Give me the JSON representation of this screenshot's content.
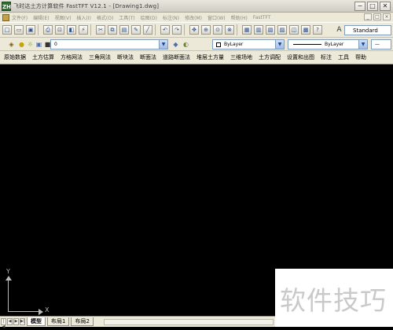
{
  "window": {
    "app_icon": "ZH",
    "title": "飞时达土方计算软件 FastTFT V12.1 - [Drawing1.dwg]",
    "minimize": "−",
    "maximize": "□",
    "close": "✕"
  },
  "menu": {
    "items": [
      "文件(F)",
      "编辑(E)",
      "视图(V)",
      "插入(I)",
      "格式(O)",
      "工具(T)",
      "绘图(D)",
      "标注(N)",
      "修改(M)",
      "窗口(W)",
      "帮助(H)",
      "FastTFT"
    ],
    "doc_min": "_",
    "doc_max": "□",
    "doc_close": "×"
  },
  "toolbar1": {
    "icons": [
      "new-icon",
      "open-icon",
      "save-icon",
      "print-icon",
      "preview-icon",
      "plot-icon",
      "publish-icon",
      "cut-icon",
      "copy-icon",
      "paste-icon",
      "match-icon",
      "brush-icon",
      "undo-icon",
      "redo-icon",
      "pan-icon",
      "zoom-realtime-icon",
      "zoom-window-icon",
      "zoom-previous-icon",
      "properties-icon",
      "design-center-icon",
      "tool-palettes-icon",
      "sheet-set-icon",
      "markup-icon",
      "calculator-icon",
      "help-icon"
    ],
    "glyphs": [
      "□",
      "▭",
      "▣",
      "⎙",
      "⊡",
      "◧",
      "⚡",
      "✂",
      "⧉",
      "▤",
      "✎",
      "╱",
      "↶",
      "↷",
      "✥",
      "⊕",
      "⊙",
      "⊗",
      "▦",
      "▥",
      "▧",
      "▨",
      "◫",
      "▩",
      "?"
    ],
    "text_style": "Standard",
    "text_style_icon": "A"
  },
  "toolbar2": {
    "layer_value": "0",
    "color_value": "ByLayer",
    "linetype_value": "ByLayer",
    "lineweight_value": "—"
  },
  "commands": [
    "原始数据",
    "土方估算",
    "方格网法",
    "三角网法",
    "断块法",
    "断面法",
    "道路断面法",
    "堆层土方量",
    "三维场地",
    "土方调配",
    "设置和出图",
    "标注",
    "工具",
    "帮助"
  ],
  "ucs": {
    "x_label": "X",
    "y_label": "Y"
  },
  "layout_tabs": [
    "模型",
    "布局1",
    "布局2"
  ],
  "nav_buttons": [
    "|◀",
    "◀",
    "▶",
    "▶|"
  ],
  "watermark": "软件技巧"
}
